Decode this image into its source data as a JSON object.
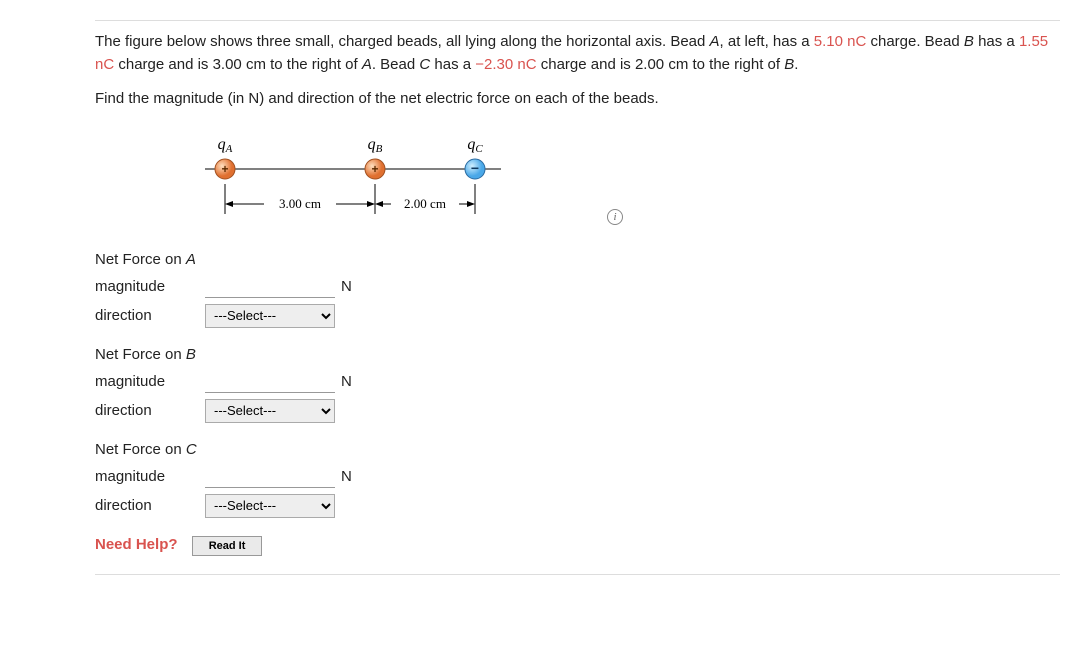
{
  "problem": {
    "line1_pre": "The figure below shows three small, charged beads, all lying along the horizontal axis. Bead ",
    "beadA": "A",
    "line1_mid1": ", at left, has a ",
    "chargeA": "5.10 nC",
    "line1_mid2": " charge. Bead ",
    "beadB1": "B",
    "line1_mid3": " has a ",
    "chargeB": "1.55 nC",
    "line1_mid4": " charge and is 3.00 cm to the right of ",
    "beadA2": "A",
    "line1_mid5": ". Bead ",
    "beadC1": "C",
    "line1_mid6": " has a ",
    "chargeC": "−2.30 nC",
    "line1_mid7": " charge and is 2.00 cm to the right of ",
    "beadB2": "B",
    "period": "."
  },
  "prompt": "Find the magnitude (in N) and direction of the net electric force on each of the beads.",
  "figure": {
    "qA": "q",
    "qA_sub": "A",
    "qB": "q",
    "qB_sub": "B",
    "qC": "q",
    "qC_sub": "C",
    "dist1": "3.00 cm",
    "dist2": "2.00 cm"
  },
  "sections": {
    "A": {
      "title_pre": "Net Force on ",
      "title_bead": "A",
      "magnitude_label": "magnitude",
      "direction_label": "direction",
      "unit": "N",
      "select": "---Select---"
    },
    "B": {
      "title_pre": "Net Force on ",
      "title_bead": "B",
      "magnitude_label": "magnitude",
      "direction_label": "direction",
      "unit": "N",
      "select": "---Select---"
    },
    "C": {
      "title_pre": "Net Force on ",
      "title_bead": "C",
      "magnitude_label": "magnitude",
      "direction_label": "direction",
      "unit": "N",
      "select": "---Select---"
    }
  },
  "help": {
    "label": "Need Help?",
    "readit": "Read It"
  },
  "info_icon": "i"
}
